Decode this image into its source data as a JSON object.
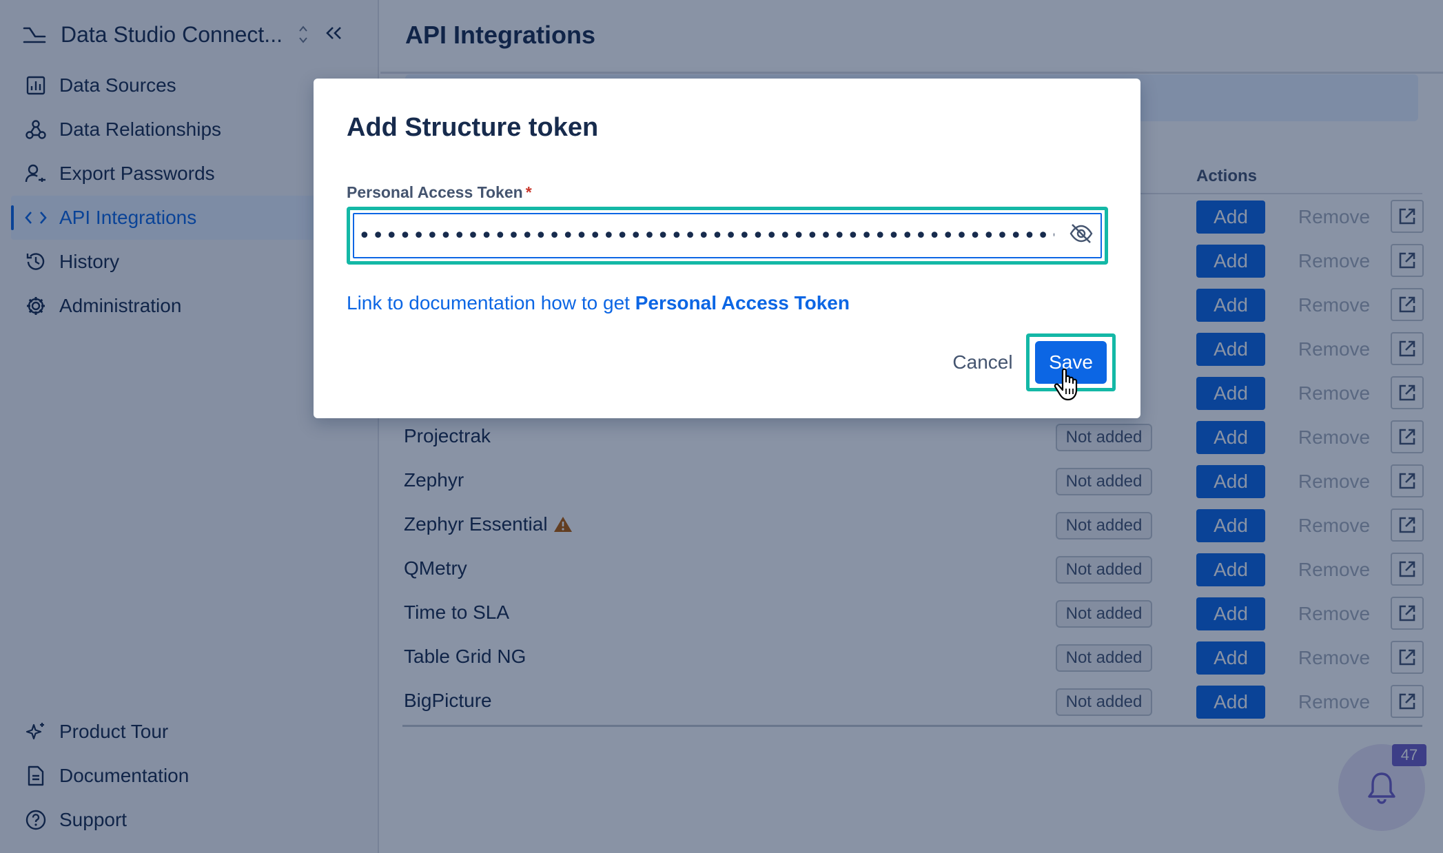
{
  "app": {
    "title": "Data Studio Connect...",
    "switch_icon": "chevron-up-down-icon",
    "collapse_icon": "double-chevron-left-icon"
  },
  "sidebar": {
    "items": [
      {
        "label": "Data Sources",
        "icon": "bar-chart-icon"
      },
      {
        "label": "Data Relationships",
        "icon": "webhook-icon"
      },
      {
        "label": "Export Passwords",
        "icon": "user-key-icon"
      },
      {
        "label": "API Integrations",
        "icon": "code-icon",
        "active": true
      },
      {
        "label": "History",
        "icon": "history-icon"
      },
      {
        "label": "Administration",
        "icon": "gear-icon"
      }
    ],
    "bottom_items": [
      {
        "label": "Product Tour",
        "icon": "sparkle-icon"
      },
      {
        "label": "Documentation",
        "icon": "document-icon"
      },
      {
        "label": "Support",
        "icon": "help-icon"
      }
    ]
  },
  "main": {
    "title": "API Integrations",
    "actions_header": "Actions",
    "rows": [
      {
        "name": "",
        "status": "",
        "add": "Add",
        "remove": "Remove"
      },
      {
        "name": "",
        "status": "",
        "add": "Add",
        "remove": "Remove"
      },
      {
        "name": "",
        "status": "",
        "add": "Add",
        "remove": "Remove"
      },
      {
        "name": "",
        "status": "",
        "add": "Add",
        "remove": "Remove"
      },
      {
        "name": "",
        "status": "",
        "add": "Add",
        "remove": "Remove"
      },
      {
        "name": "Projectrak",
        "status": "Not added",
        "add": "Add",
        "remove": "Remove"
      },
      {
        "name": "Zephyr",
        "status": "Not added",
        "add": "Add",
        "remove": "Remove"
      },
      {
        "name": "Zephyr Essential",
        "status": "Not added",
        "add": "Add",
        "remove": "Remove",
        "warning": true
      },
      {
        "name": "QMetry",
        "status": "Not added",
        "add": "Add",
        "remove": "Remove"
      },
      {
        "name": "Time to SLA",
        "status": "Not added",
        "add": "Add",
        "remove": "Remove"
      },
      {
        "name": "Table Grid NG",
        "status": "Not added",
        "add": "Add",
        "remove": "Remove"
      },
      {
        "name": "BigPicture",
        "status": "Not added",
        "add": "Add",
        "remove": "Remove"
      }
    ]
  },
  "notifications": {
    "count": "47",
    "icon": "bell-icon"
  },
  "modal": {
    "title": "Add Structure token",
    "field_label": "Personal Access Token",
    "required_mark": "*",
    "token_value": "••••••••••••••••••••••••••••••••••••••••••••••••••••••••••••••••••••••••••••••••••••••••••••••••",
    "eye_icon": "eye-off-icon",
    "link_prefix": "Link to documentation how to get ",
    "link_bold": "Personal Access Token",
    "cancel_label": "Cancel",
    "save_label": "Save"
  },
  "colors": {
    "primary": "#0c66e4",
    "highlight": "#14b8a6",
    "warning": "#b65c02",
    "badge_purple": "#6e5dc6"
  }
}
